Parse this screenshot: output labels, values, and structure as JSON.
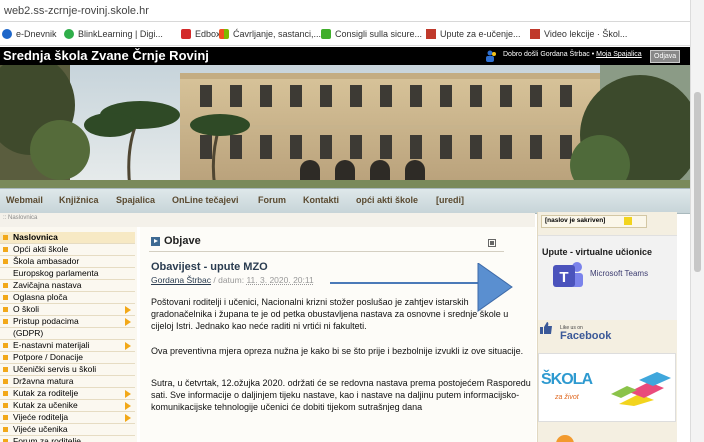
{
  "browser": {
    "url": "web2.ss-zcrnje-rovinj.skole.hr",
    "bookmarks": [
      {
        "label": "e-Dnevnik",
        "icon": "edn-icon"
      },
      {
        "label": "BlinkLearning | Digi...",
        "icon": "blink-icon"
      },
      {
        "label": "Edbox",
        "icon": "edbox-icon"
      },
      {
        "label": "Ćavrljanje, sastanci,...",
        "icon": "windows-icon"
      },
      {
        "label": "Consigli sulla sicure...",
        "icon": "green-tag-icon"
      },
      {
        "label": "Upute za e-učenje...",
        "icon": "hat-icon"
      },
      {
        "label": "Video lekcije · Škol...",
        "icon": "hat-icon"
      }
    ]
  },
  "header": {
    "title": "Srednja škola Zvane Črnje Rovinj",
    "welcome": "Dobro došli Gordana Štrbac",
    "separator": " • ",
    "my_link": "Moja Spajalica",
    "logout": "Odjava"
  },
  "nav": {
    "items": [
      "Webmail",
      "Knjižnica",
      "Spajalica",
      "OnLine tečajevi",
      "Forum",
      "Kontakti",
      "opći akti škole",
      "[uredi]"
    ]
  },
  "breadcrumb": ":: Naslovnica",
  "sidebar": {
    "items": [
      {
        "label": "Naslovnica",
        "active": true,
        "arrow": false
      },
      {
        "label": "Opći akti škole",
        "active": false,
        "arrow": false
      },
      {
        "label": "Škola ambasador",
        "active": false,
        "arrow": false
      },
      {
        "label": "Europskog parlamenta",
        "active": false,
        "arrow": false,
        "continuation": true
      },
      {
        "label": "Zavičajna nastava",
        "active": false,
        "arrow": false
      },
      {
        "label": "Oglasna ploča",
        "active": false,
        "arrow": false
      },
      {
        "label": "O školi",
        "active": false,
        "arrow": true
      },
      {
        "label": "Pristup podacima",
        "active": false,
        "arrow": true
      },
      {
        "label": "(GDPR)",
        "active": false,
        "arrow": false,
        "continuation": true
      },
      {
        "label": "E-nastavni materijali",
        "active": false,
        "arrow": true
      },
      {
        "label": "Potpore / Donacije",
        "active": false,
        "arrow": false
      },
      {
        "label": "Učenički servis u školi",
        "active": false,
        "arrow": false
      },
      {
        "label": "Državna matura",
        "active": false,
        "arrow": false
      },
      {
        "label": "Kutak za roditelje",
        "active": false,
        "arrow": true
      },
      {
        "label": "Kutak za učenike",
        "active": false,
        "arrow": true
      },
      {
        "label": "Vijeće roditelja",
        "active": false,
        "arrow": true
      },
      {
        "label": "Vijeće učenika",
        "active": false,
        "arrow": false
      },
      {
        "label": "Forum za roditelje",
        "active": false,
        "arrow": false
      }
    ]
  },
  "content": {
    "section_title": "Objave",
    "post_title": "Obavijest - upute MZO",
    "post_author": "Gordana Štrbac",
    "post_meta_sep": " / datum: ",
    "post_date": "11. 3. 2020. 20:11",
    "paragraphs": [
      "Poštovani roditelji i učenici, Nacionalni krizni stožer poslušao je zahtjev istarskih gradonačelnika i župana te je od petka obustavljena nastava za osnovne i srednje škole u cijeloj Istri.  Jednako kao neće raditi ni vrtići ni fakulteti.",
      "Ova preventivna mjera opreza nužna je kako bi se što prije i bezbolnije izvukli iz ove situacije.",
      "Sutra, u četvrtak, 12.ožujka 2020. održati će se redovna nastava prema postojećem Rasporedu sati. Sve informacije o daljinjem tijeku nastave, kao i nastave na daljinu putem informacijsko-komunikacijske tehnologije učenici će dobiti tijekom sutrašnjeg dana"
    ]
  },
  "right": {
    "hidden_title": "[naslov je sakriven]",
    "teams_heading": "Upute - virtualne učionice",
    "teams_label": "Microsoft Teams",
    "fb_small": "Like us on",
    "fb_big": "Facebook",
    "skola_text": "ŠKOLA",
    "skola_sub": "za život"
  },
  "colors": {
    "accent_orange": "#f2a818",
    "nav_text": "#5a4a30",
    "teams_purple": "#4b53bc",
    "facebook_blue": "#3b5998",
    "annotation_blue": "#4a7ab8"
  }
}
